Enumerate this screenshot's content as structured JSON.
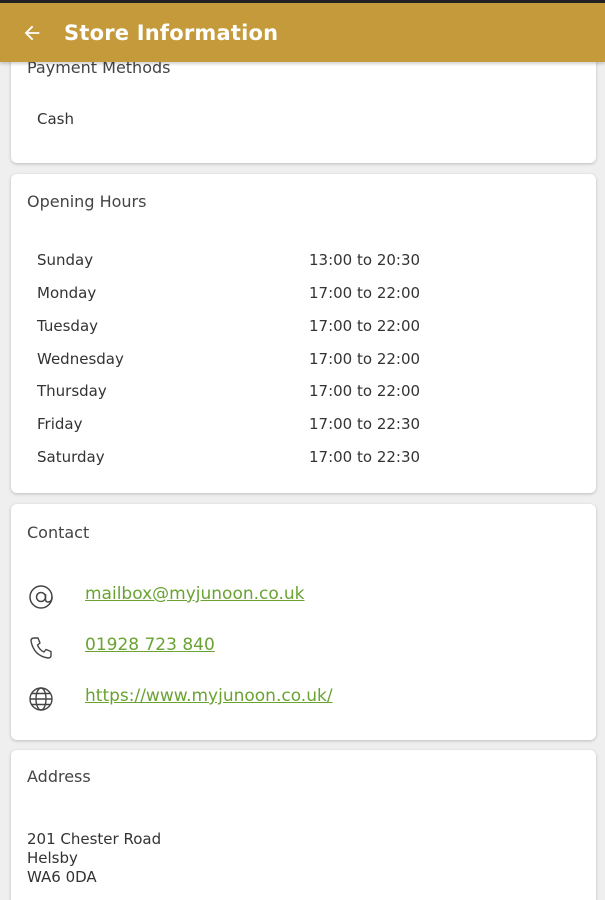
{
  "header": {
    "title": "Store Information",
    "back_icon": "arrow-left-icon"
  },
  "payment": {
    "title": "Payment Methods",
    "methods": [
      "Cash"
    ]
  },
  "hours": {
    "title": "Opening Hours",
    "rows": [
      {
        "day": "Sunday",
        "time": "13:00 to 20:30"
      },
      {
        "day": "Monday",
        "time": "17:00 to 22:00"
      },
      {
        "day": "Tuesday",
        "time": "17:00 to 22:00"
      },
      {
        "day": "Wednesday",
        "time": "17:00 to 22:00"
      },
      {
        "day": "Thursday",
        "time": "17:00 to 22:00"
      },
      {
        "day": "Friday",
        "time": "17:00 to 22:30"
      },
      {
        "day": "Saturday",
        "time": "17:00 to 22:30"
      }
    ]
  },
  "contact": {
    "title": "Contact",
    "email": "mailbox@myjunoon.co.uk",
    "phone": "01928 723 840",
    "website": "https://www.myjunoon.co.uk/",
    "icons": [
      "at-icon",
      "phone-icon",
      "globe-icon"
    ]
  },
  "address": {
    "title": "Address",
    "lines": [
      "201 Chester Road",
      "Helsby",
      "WA6 0DA"
    ]
  },
  "colors": {
    "header": "#c49a3a",
    "link": "#6aa332",
    "background": "#efefef"
  }
}
